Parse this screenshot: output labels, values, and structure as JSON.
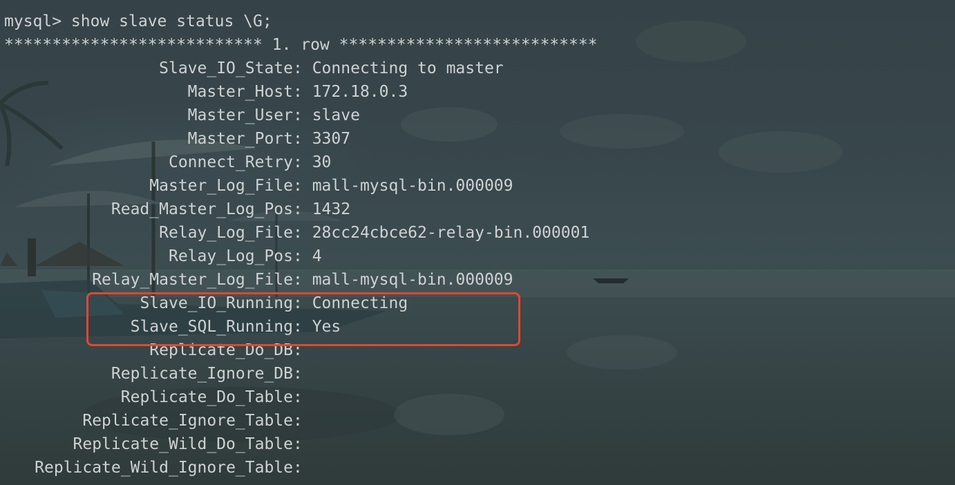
{
  "command": "mysql> show slave status \\G;",
  "row_header": "*************************** 1. row ***************************",
  "fields": [
    {
      "label": "Slave_IO_State",
      "value": "Connecting to master"
    },
    {
      "label": "Master_Host",
      "value": "172.18.0.3"
    },
    {
      "label": "Master_User",
      "value": "slave"
    },
    {
      "label": "Master_Port",
      "value": "3307"
    },
    {
      "label": "Connect_Retry",
      "value": "30"
    },
    {
      "label": "Master_Log_File",
      "value": "mall-mysql-bin.000009"
    },
    {
      "label": "Read_Master_Log_Pos",
      "value": "1432"
    },
    {
      "label": "Relay_Log_File",
      "value": "28cc24cbce62-relay-bin.000001"
    },
    {
      "label": "Relay_Log_Pos",
      "value": "4"
    },
    {
      "label": "Relay_Master_Log_File",
      "value": "mall-mysql-bin.000009"
    },
    {
      "label": "Slave_IO_Running",
      "value": "Connecting"
    },
    {
      "label": "Slave_SQL_Running",
      "value": "Yes"
    },
    {
      "label": "Replicate_Do_DB",
      "value": ""
    },
    {
      "label": "Replicate_Ignore_DB",
      "value": ""
    },
    {
      "label": "Replicate_Do_Table",
      "value": ""
    },
    {
      "label": "Replicate_Ignore_Table",
      "value": ""
    },
    {
      "label": "Replicate_Wild_Do_Table",
      "value": ""
    },
    {
      "label": "Replicate_Wild_Ignore_Table",
      "value": ""
    }
  ],
  "separator": ": ",
  "colors": {
    "text": "#cfd2d2",
    "highlight_border": "#e2472f"
  }
}
